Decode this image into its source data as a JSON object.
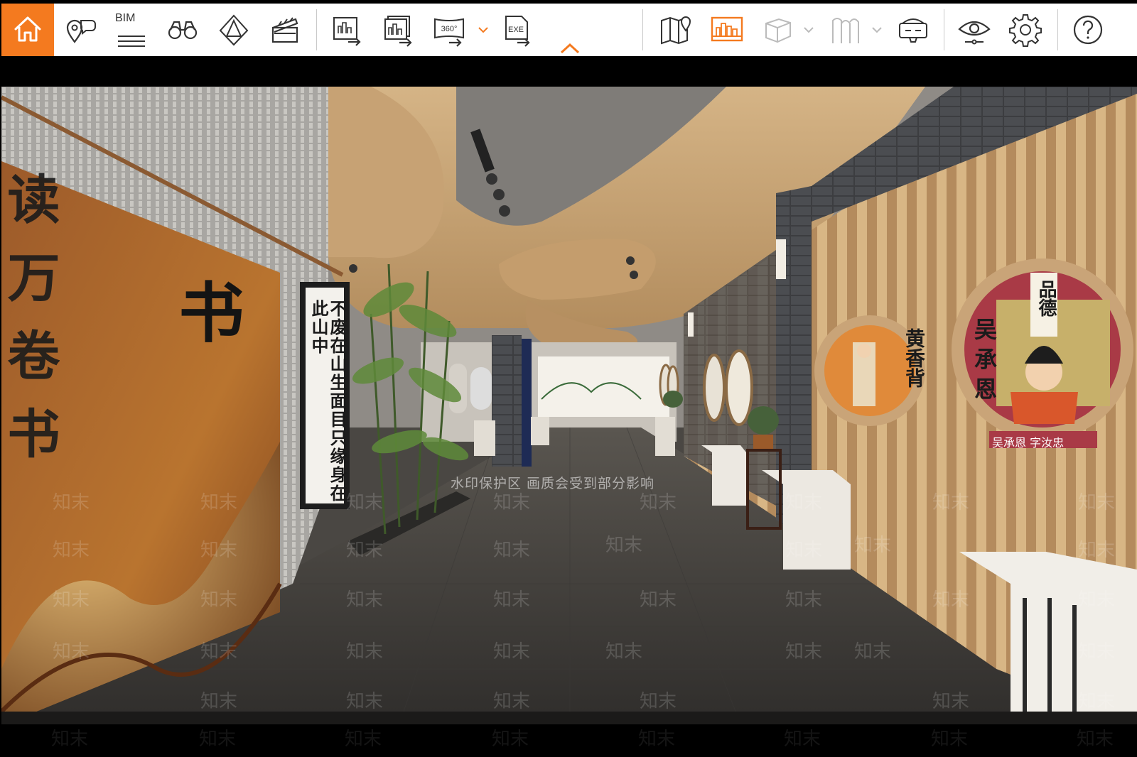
{
  "toolbar": {
    "accent_color": "#f47a1f",
    "items": [
      {
        "name": "home",
        "icon": "house-icon",
        "active": true
      },
      {
        "name": "location-annotation",
        "icon": "pin-chat-icon"
      },
      {
        "name": "bim",
        "icon": "bim-icon",
        "label": "BIM"
      },
      {
        "name": "walkthrough",
        "icon": "binoculars-icon"
      },
      {
        "name": "sun-shadow",
        "icon": "pyramid-icon"
      },
      {
        "name": "animation",
        "icon": "clapperboard-icon"
      },
      {
        "name": "export-image",
        "icon": "export-image-icon"
      },
      {
        "name": "export-batch",
        "icon": "export-batch-icon"
      },
      {
        "name": "export-360",
        "icon": "export-360-icon",
        "label": "360°"
      },
      {
        "name": "export-exe",
        "icon": "export-exe-icon",
        "label": "EXE"
      },
      {
        "name": "map",
        "icon": "map-icon"
      },
      {
        "name": "scene-list",
        "icon": "scene-list-icon",
        "active": true
      },
      {
        "name": "model",
        "icon": "cube-icon"
      },
      {
        "name": "materials",
        "icon": "cloth-icon"
      },
      {
        "name": "vr",
        "icon": "vr-headset-icon"
      },
      {
        "name": "view",
        "icon": "eye-icon"
      },
      {
        "name": "settings",
        "icon": "gear-icon"
      },
      {
        "name": "help",
        "icon": "help-icon"
      }
    ]
  },
  "scene": {
    "wall_character": "书",
    "scroll_text": "不废在山生面目只缘身在此山中",
    "roundel1_text": "黄香背",
    "roundel2_title": "吴承恩",
    "roundel2_banner": "品德",
    "roundel2_caption": "吴承恩 字汝忠",
    "left_panel_chars": "读万卷书",
    "watermark_notice": "水印保护区 画质会受到部分影响",
    "watermark": "知末"
  }
}
